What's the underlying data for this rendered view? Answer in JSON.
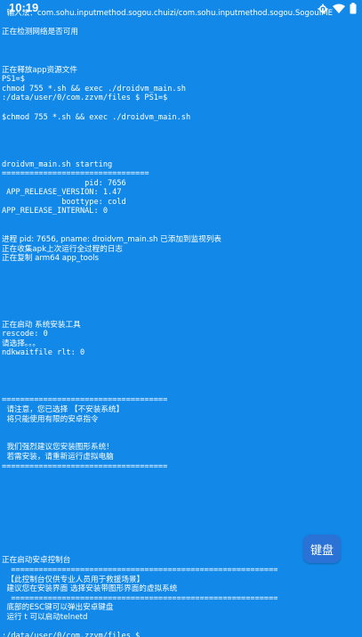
{
  "status_bar": {
    "time": "10:19",
    "icons": [
      "settings-icon",
      "wifi-icon",
      "battery-icon"
    ]
  },
  "terminal": {
    "lines": [
      "  输入法：com.sohu.inputmethod.sogou.chuizi/com.sohu.inputmethod.sogou.SogouIME",
      "",
      "正在检测网络是否可用",
      "",
      "",
      "",
      "正在释放app资源文件",
      "PS1=$",
      "chmod 755 *.sh && exec ./droidvm_main.sh",
      ":/data/user/0/com.zzvm/files $ PS1=$",
      "",
      "$chmod 755 *.sh && exec ./droidvm_main.sh",
      "",
      "",
      "",
      "",
      "droidvm_main.sh starting",
      "================================",
      "                  pid: 7656",
      " APP_RELEASE_VERSION: 1.47",
      "             boottype: cold",
      "APP_RELEASE_INTERNAL: 0",
      "",
      "",
      "进程 pid: 7656, pname: droidvm_main.sh 已添加到监视列表",
      "正在收集apk上次运行全过程的日志",
      "正在复制 arm64 app_tools",
      "",
      "",
      "",
      "",
      "",
      "",
      "正在启动 系统安装工具",
      "rescode: 0",
      "请选择。。。",
      "ndkwaitfile rlt: 0",
      "",
      "",
      "",
      "",
      "====================================",
      "  请注意，您已选择 【不安装系统】",
      "  将只能使用有限的安卓指令",
      "",
      "",
      "  我们强烈建议您安装图形系统！",
      "  若需安装，请重新运行虚拟电脑",
      "====================================",
      "",
      "",
      "",
      "",
      "",
      "",
      "",
      "",
      "",
      "正在启动安卓控制台",
      "  ==========================================================",
      "  【此控制台仅供专业人员用于救援场景】",
      "  建议您在安装界面 选择安装带图形界面的虚拟系统",
      "  ==========================================================",
      "  底部的ESC键可以弹出安卓键盘",
      "  运行 t 可以启动telnetd",
      "",
      ":/data/user/0/com.zzvm/files $"
    ]
  },
  "keyboard_button": {
    "label": "键盘"
  },
  "colors": {
    "background": "#1289e8",
    "text": "#ffffff",
    "button": "#2a72d6"
  }
}
